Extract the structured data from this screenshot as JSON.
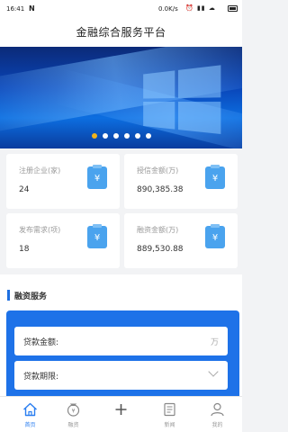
{
  "status_bar": {
    "time": "16:41",
    "notification": "N",
    "network_speed": "0.0K/s",
    "icons": "⏰ ▮▮ ☁"
  },
  "header": {
    "title": "金融综合服务平台"
  },
  "banner": {
    "dots_count": 6,
    "active_dot": 0
  },
  "stats": [
    {
      "label": "注册企业(家)",
      "value": "24",
      "icon": "yuan-clipboard-icon",
      "icon_glyph": "¥"
    },
    {
      "label": "授信金额(万)",
      "value": "890,385.38",
      "icon": "yuan-clipboard-icon",
      "icon_glyph": "¥"
    },
    {
      "label": "发布需求(项)",
      "value": "18",
      "icon": "yuan-clipboard-icon",
      "icon_glyph": "¥"
    },
    {
      "label": "融资金额(万)",
      "value": "889,530.88",
      "icon": "yuan-clipboard-icon",
      "icon_glyph": "¥"
    }
  ],
  "section": {
    "title": "融资服务"
  },
  "form": {
    "amount_label": "贷款金额:",
    "amount_unit": "万",
    "term_label": "贷款期限:"
  },
  "tabs": [
    {
      "label": "首页",
      "icon": "home-icon",
      "active": true
    },
    {
      "label": "融资",
      "icon": "money-bag-icon",
      "active": false
    },
    {
      "label": "",
      "icon": "plus-icon",
      "active": false
    },
    {
      "label": "新闻",
      "icon": "news-icon",
      "active": false
    },
    {
      "label": "我的",
      "icon": "user-icon",
      "active": false
    }
  ],
  "colors": {
    "accent": "#1e72e8",
    "active_dot": "#f2b31c",
    "icon_bg": "#4aa3ee"
  }
}
